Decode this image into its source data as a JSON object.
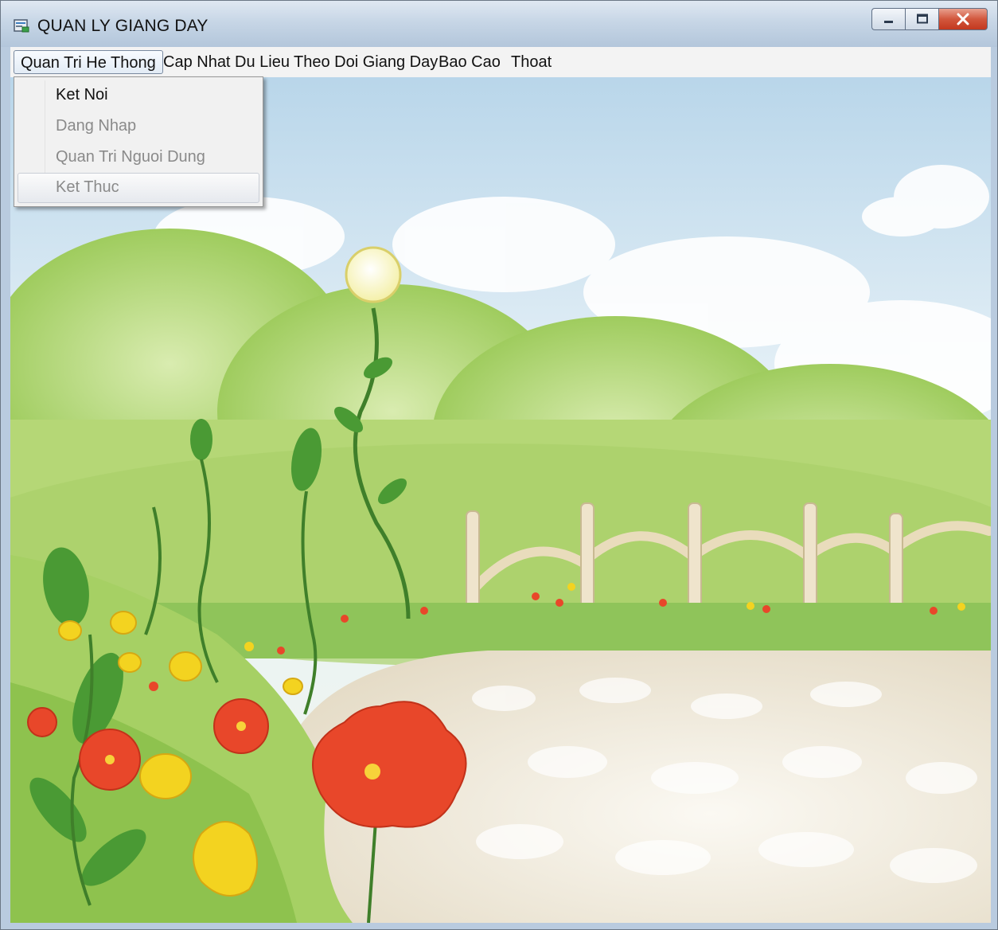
{
  "window": {
    "title": "QUAN LY GIANG DAY",
    "controls": [
      "minimize-icon",
      "maximize-icon",
      "close-icon"
    ]
  },
  "menubar": {
    "items": [
      {
        "label": "Quan Tri He Thong",
        "open": true
      },
      {
        "label": "Cap Nhat Du Lieu"
      },
      {
        "label": "Theo Doi Giang Day"
      },
      {
        "label": "Bao Cao"
      },
      {
        "label": "Thoat"
      }
    ]
  },
  "dropdown": {
    "items": [
      {
        "label": "Ket Noi",
        "enabled": true
      },
      {
        "label": "Dang Nhap",
        "enabled": false
      },
      {
        "label": "Quan Tri Nguoi Dung",
        "enabled": false
      },
      {
        "label": "Ket Thuc",
        "enabled": false,
        "highlighted": true
      }
    ]
  },
  "background": {
    "description_colors": {
      "sky": "#e6f1f8",
      "foliage": "#b7d97a",
      "path": "#f1ece0",
      "flower_red": "#e8472a",
      "flower_yellow": "#f3d320",
      "fence": "#efe3c8"
    }
  }
}
